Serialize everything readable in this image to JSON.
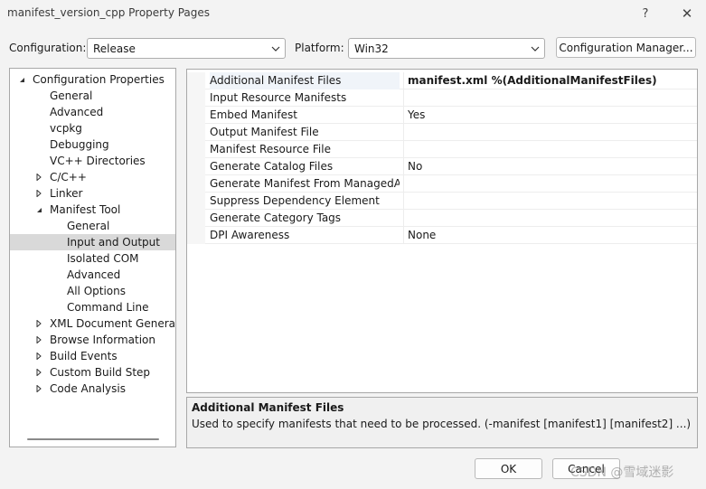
{
  "window": {
    "title": "manifest_version_cpp Property Pages",
    "help_glyph": "?",
    "close_glyph": "✕"
  },
  "config": {
    "label": "Configuration:",
    "value": "Release",
    "platform_label": "Platform:",
    "platform_value": "Win32",
    "manager_button": "Configuration Manager..."
  },
  "tree": {
    "items": [
      {
        "label": "Configuration Properties",
        "level": 0,
        "expander": "open"
      },
      {
        "label": "General",
        "level": 1,
        "expander": "none"
      },
      {
        "label": "Advanced",
        "level": 1,
        "expander": "none"
      },
      {
        "label": "vcpkg",
        "level": 1,
        "expander": "none"
      },
      {
        "label": "Debugging",
        "level": 1,
        "expander": "none"
      },
      {
        "label": "VC++ Directories",
        "level": 1,
        "expander": "none"
      },
      {
        "label": "C/C++",
        "level": 1,
        "expander": "closed"
      },
      {
        "label": "Linker",
        "level": 1,
        "expander": "closed"
      },
      {
        "label": "Manifest Tool",
        "level": 1,
        "expander": "open"
      },
      {
        "label": "General",
        "level": 2,
        "expander": "none"
      },
      {
        "label": "Input and Output",
        "level": 2,
        "expander": "none",
        "selected": true
      },
      {
        "label": "Isolated COM",
        "level": 2,
        "expander": "none"
      },
      {
        "label": "Advanced",
        "level": 2,
        "expander": "none"
      },
      {
        "label": "All Options",
        "level": 2,
        "expander": "none"
      },
      {
        "label": "Command Line",
        "level": 2,
        "expander": "none"
      },
      {
        "label": "XML Document Generator",
        "level": 1,
        "expander": "closed"
      },
      {
        "label": "Browse Information",
        "level": 1,
        "expander": "closed"
      },
      {
        "label": "Build Events",
        "level": 1,
        "expander": "closed"
      },
      {
        "label": "Custom Build Step",
        "level": 1,
        "expander": "closed"
      },
      {
        "label": "Code Analysis",
        "level": 1,
        "expander": "closed"
      }
    ]
  },
  "properties": [
    {
      "name": "Additional Manifest Files",
      "value": "manifest.xml %(AdditionalManifestFiles)",
      "bold": true
    },
    {
      "name": "Input Resource Manifests",
      "value": ""
    },
    {
      "name": "Embed Manifest",
      "value": "Yes"
    },
    {
      "name": "Output Manifest File",
      "value": ""
    },
    {
      "name": "Manifest Resource File",
      "value": ""
    },
    {
      "name": "Generate Catalog Files",
      "value": "No"
    },
    {
      "name": "Generate Manifest From ManagedAssembly",
      "value": ""
    },
    {
      "name": "Suppress Dependency Element",
      "value": ""
    },
    {
      "name": "Generate Category Tags",
      "value": ""
    },
    {
      "name": "DPI Awareness",
      "value": "None"
    }
  ],
  "description": {
    "title": "Additional Manifest Files",
    "text": "Used to specify manifests that need to be processed.     (-manifest [manifest1] [manifest2] ...)"
  },
  "buttons": {
    "ok": "OK",
    "cancel": "Cancel"
  },
  "watermark": "CSDN @雪域迷影"
}
